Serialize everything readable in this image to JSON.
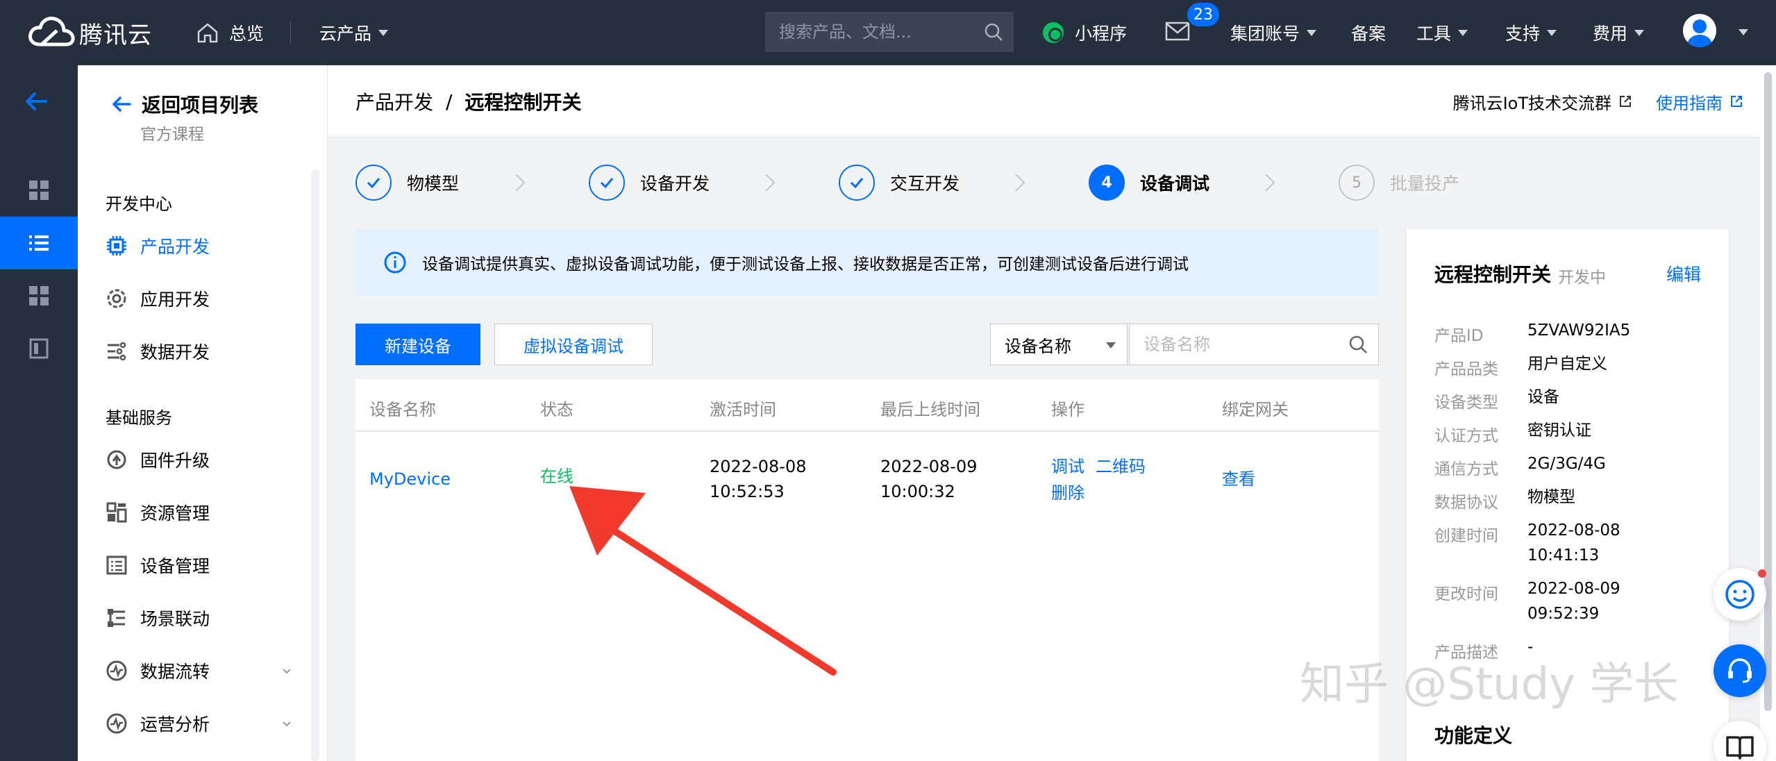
{
  "topnav": {
    "brand": "腾讯云",
    "overview": "总览",
    "products": "云产品",
    "search_placeholder": "搜索产品、文档...",
    "miniapp": "小程序",
    "mail_count": "23",
    "items": [
      "集团账号",
      "备案",
      "工具",
      "支持",
      "费用"
    ]
  },
  "sidebar": {
    "back_title": "返回项目列表",
    "back_sub": "官方课程",
    "group1": "开发中心",
    "group1_items": [
      "产品开发",
      "应用开发",
      "数据开发"
    ],
    "group2": "基础服务",
    "group2_items": [
      "固件升级",
      "资源管理",
      "设备管理",
      "场景联动",
      "数据流转",
      "运营分析"
    ]
  },
  "header": {
    "crumb_parent": "产品开发",
    "crumb_sep": "/",
    "crumb_current": "远程控制开关",
    "link_group": "腾讯云IoT技术交流群",
    "link_guide": "使用指南"
  },
  "steps": [
    {
      "label": "物模型",
      "num": ""
    },
    {
      "label": "设备开发",
      "num": ""
    },
    {
      "label": "交互开发",
      "num": ""
    },
    {
      "label": "设备调试",
      "num": "4"
    },
    {
      "label": "批量投产",
      "num": "5"
    }
  ],
  "banner": "设备调试提供真实、虚拟设备调试功能，便于测试设备上报、接收数据是否正常，可创建测试设备后进行调试",
  "toolbar": {
    "new_device": "新建设备",
    "virtual_debug": "虚拟设备调试",
    "filter_select": "设备名称",
    "search_placeholder": "设备名称"
  },
  "table": {
    "columns": [
      "设备名称",
      "状态",
      "激活时间",
      "最后上线时间",
      "操作",
      "绑定网关"
    ],
    "rows": [
      {
        "name": "MyDevice",
        "status": "在线",
        "activated_date": "2022-08-08",
        "activated_time": "10:52:53",
        "last_online_date": "2022-08-09",
        "last_online_time": "10:00:32",
        "action_debug": "调试",
        "action_qr": "二维码",
        "action_delete": "删除",
        "gateway": "查看"
      }
    ]
  },
  "card": {
    "title": "远程控制开关",
    "status": "开发中",
    "edit": "编辑",
    "fields": [
      {
        "k": "产品ID",
        "v": "5ZVAW92IA5"
      },
      {
        "k": "产品品类",
        "v": "用户自定义"
      },
      {
        "k": "设备类型",
        "v": "设备"
      },
      {
        "k": "认证方式",
        "v": "密钥认证"
      },
      {
        "k": "通信方式",
        "v": "2G/3G/4G"
      },
      {
        "k": "数据协议",
        "v": "物模型"
      },
      {
        "k": "创建时间",
        "v": "2022-08-08",
        "v2": "10:41:13"
      },
      {
        "k": "更改时间",
        "v": "2022-08-09",
        "v2": "09:52:39"
      },
      {
        "k": "产品描述",
        "v": "-"
      }
    ],
    "section": "功能定义"
  },
  "watermark": "知乎 @Study 学长",
  "colors": {
    "primary": "#006eff",
    "topbar": "#262f3e",
    "online": "#0abf5b",
    "annotation": "#f23a2c"
  }
}
